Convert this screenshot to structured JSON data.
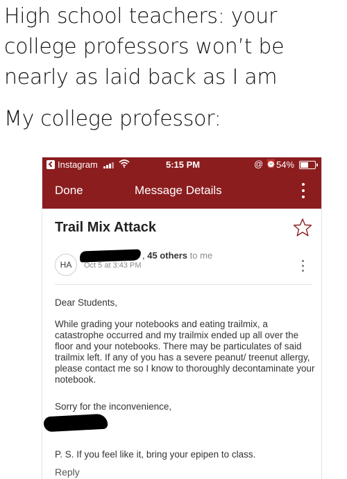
{
  "meme": {
    "caption_top": "High school teachers: your college professors won’t be nearly as laid back as I am",
    "caption_bottom": "My college professor:"
  },
  "status_bar": {
    "carrier": "Instagram",
    "time": "5:15 PM",
    "at_symbol": "@",
    "alarm_symbol": "⏰",
    "battery": "54%",
    "battery_level": 0.54,
    "color": "#8b1d1f"
  },
  "nav": {
    "done_label": "Done",
    "title": "Message Details"
  },
  "email": {
    "subject": "Trail Mix Attack",
    "avatar_initials": "HA",
    "others": "45 others",
    "to_me": "to me",
    "date": "Oct 5 at 3:43 PM",
    "greeting": "Dear Students,",
    "paragraph": "While grading your notebooks and eating trailmix, a catastrophe occurred and my trailmix ended up all over the floor and your notebooks. There may be particulates of said trailmix left. If any of you has a severe peanut/ treenut allergy, please contact me so I know  to thoroughly decontaminate your notebook.",
    "closing": "Sorry for the inconvenience,",
    "ps": "P. S. If you feel like it, bring your epipen to class.",
    "reply_label": "Reply"
  }
}
